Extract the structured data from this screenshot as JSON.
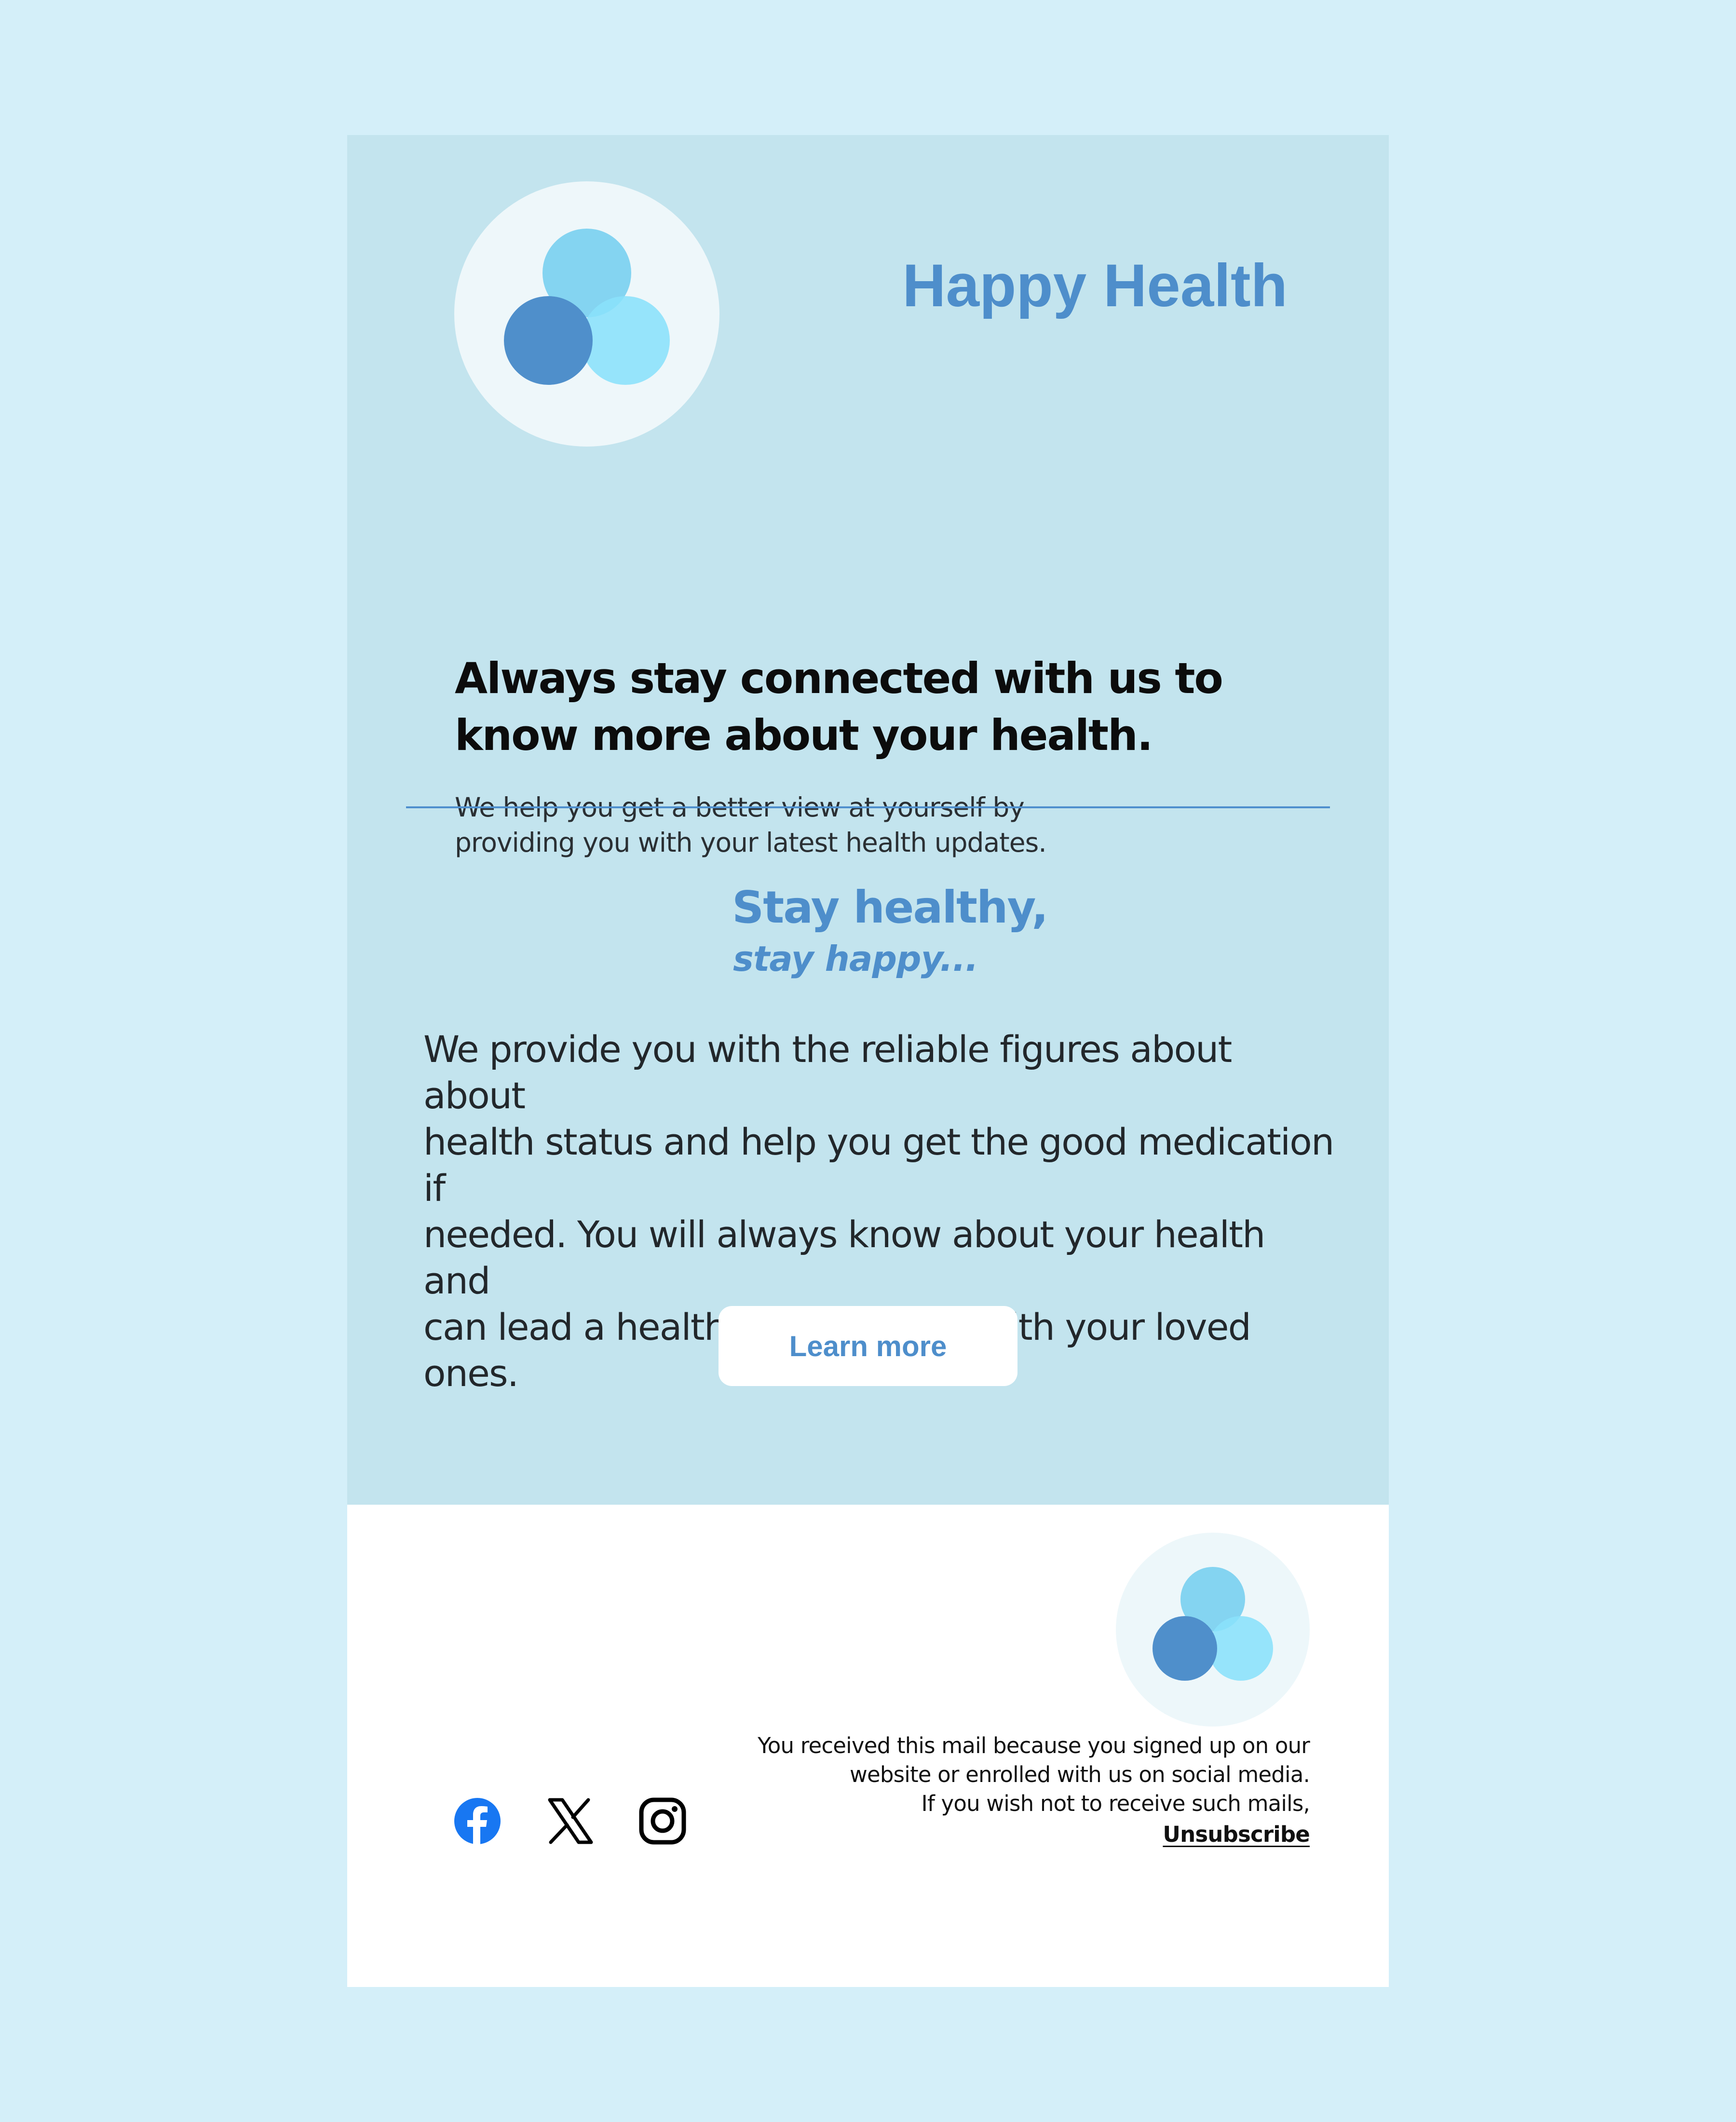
{
  "brand": {
    "name": "Happy Health",
    "logo_icon": "three-circles-logo-icon"
  },
  "hero": {
    "headline_line1": "Always stay connected with us to",
    "headline_line2": "know more about your health.",
    "subtext_line1": "We help you get a better view at yourself by",
    "subtext_line2": "providing you with your latest health updates."
  },
  "tagline": {
    "line1": "Stay healthy,",
    "line2": "stay happy..."
  },
  "body": {
    "line1": "We provide you with the reliable figures about about",
    "line2": "health status and help you get the good medication if",
    "line3": "needed. You will always know about your health and",
    "line4": "can lead a healthy & happy life with your loved ones."
  },
  "cta": {
    "label": "Learn more"
  },
  "footer": {
    "social": [
      "facebook-icon",
      "x-icon",
      "instagram-icon"
    ],
    "notice_line1": "You received this mail because you signed up on our",
    "notice_line2": "website or enrolled with us on social media.",
    "notice_line3": "If you wish not to receive such mails,",
    "unsubscribe_label": "Unsubscribe"
  },
  "colors": {
    "page_background": "#d4eff9",
    "hero_background": "#c3e4ee",
    "accent": "#4e8ecb",
    "logo_circle_dark": "#4f8fcb",
    "logo_circle_mid": "#78cff0",
    "logo_circle_light": "#8ae1fb",
    "facebook": "#1877f2"
  }
}
